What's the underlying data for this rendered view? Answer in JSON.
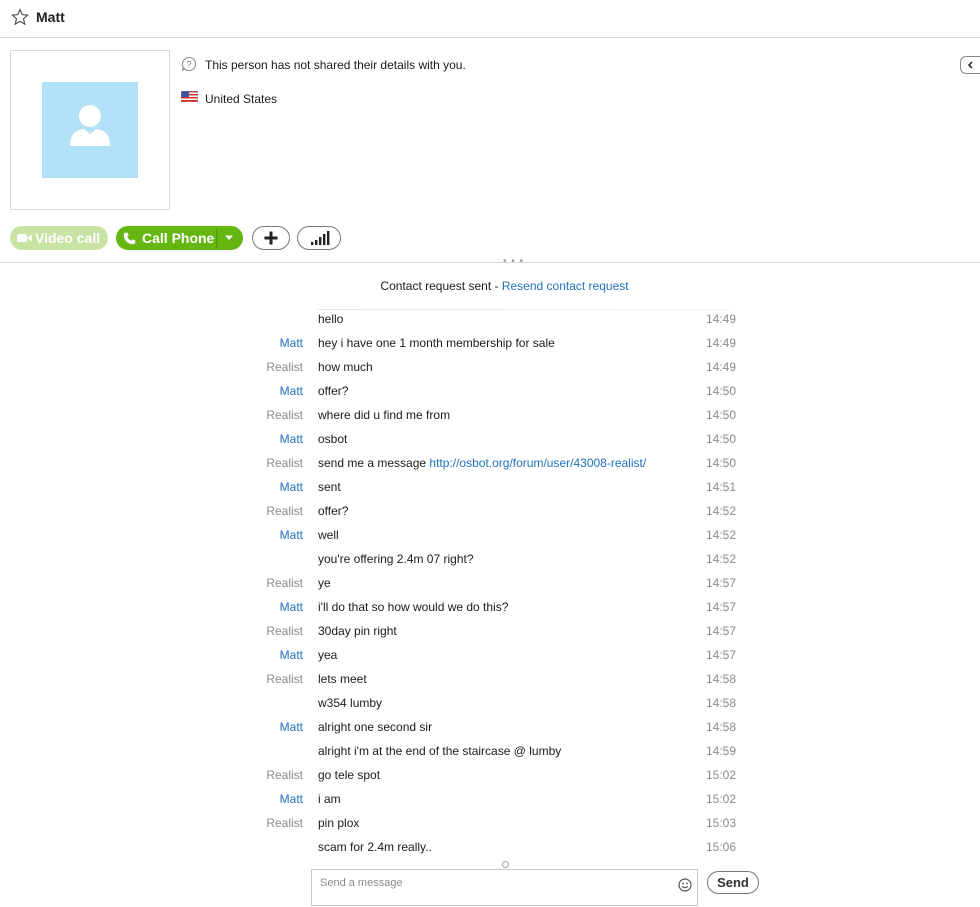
{
  "header": {
    "title": "Matt",
    "star_icon": "star-icon"
  },
  "profile": {
    "info_text": "This person has not shared their details with you.",
    "country": "United States",
    "avatar_bg": "#b3e2f8"
  },
  "actions": {
    "video_call": "Video call",
    "call_phone": "Call Phone"
  },
  "request": {
    "sent": "Contact request sent",
    "separator": " - ",
    "resend": "Resend contact request"
  },
  "messages": [
    {
      "sender": "",
      "text": "hello",
      "time": "14:49"
    },
    {
      "sender": "Matt",
      "text": "hey i have one 1 month membership for sale",
      "time": "14:49"
    },
    {
      "sender": "Realist",
      "text": "how much",
      "time": "14:49"
    },
    {
      "sender": "Matt",
      "text": "offer?",
      "time": "14:50"
    },
    {
      "sender": "Realist",
      "text": "where did u find me from",
      "time": "14:50"
    },
    {
      "sender": "Matt",
      "text": "osbot",
      "time": "14:50"
    },
    {
      "sender": "Realist",
      "text": "send me a message ",
      "link": "http://osbot.org/forum/user/43008-realist/",
      "time": "14:50"
    },
    {
      "sender": "Matt",
      "text": "sent",
      "time": "14:51"
    },
    {
      "sender": "Realist",
      "text": "offer?",
      "time": "14:52"
    },
    {
      "sender": "Matt",
      "text": "well",
      "time": "14:52"
    },
    {
      "sender": "",
      "text": "you're offering 2.4m 07 right?",
      "time": "14:52"
    },
    {
      "sender": "Realist",
      "text": "ye",
      "time": "14:57"
    },
    {
      "sender": "Matt",
      "text": "i'll do that so how would we do this?",
      "time": "14:57"
    },
    {
      "sender": "Realist",
      "text": "30day pin right",
      "time": "14:57"
    },
    {
      "sender": "Matt",
      "text": "yea",
      "time": "14:57"
    },
    {
      "sender": "Realist",
      "text": "lets meet",
      "time": "14:58"
    },
    {
      "sender": "",
      "text": "w354 lumby",
      "time": "14:58"
    },
    {
      "sender": "Matt",
      "text": "alright one second sir",
      "time": "14:58"
    },
    {
      "sender": "",
      "text": "alright i'm at the end of the staircase @ lumby",
      "time": "14:59"
    },
    {
      "sender": "Realist",
      "text": "go tele spot",
      "time": "15:02"
    },
    {
      "sender": "Matt",
      "text": "i am",
      "time": "15:02"
    },
    {
      "sender": "Realist",
      "text": "pin plox",
      "time": "15:03"
    },
    {
      "sender": "",
      "text": "scam for 2.4m really..",
      "time": "15:06"
    }
  ],
  "composer": {
    "placeholder": "Send a message",
    "send": "Send"
  },
  "colors": {
    "accent_green": "#65b611",
    "link_blue": "#1e73be"
  }
}
